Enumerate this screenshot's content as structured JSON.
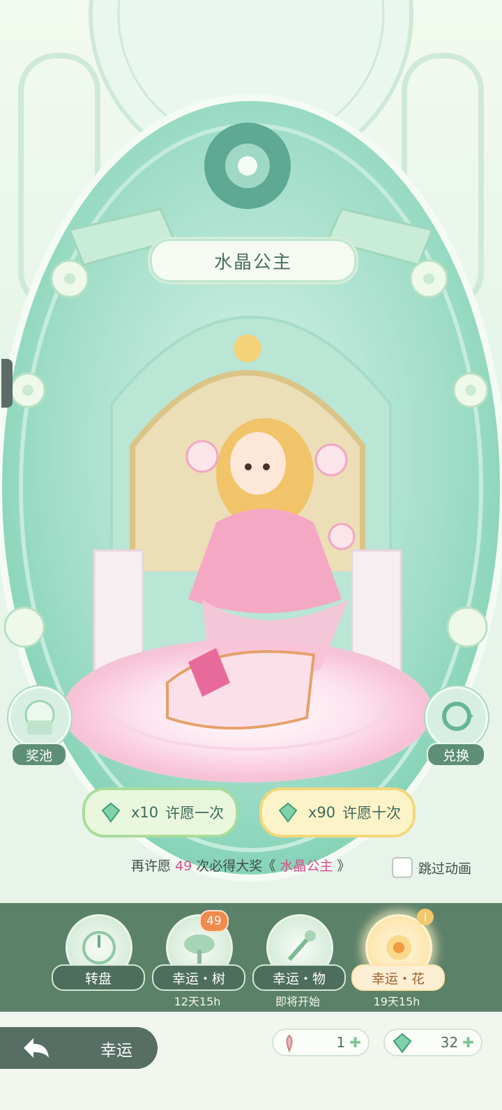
{
  "banner": {
    "title": "水晶公主"
  },
  "side_buttons": {
    "pool_label": "奖池",
    "exchange_label": "兑换"
  },
  "wish": {
    "single": {
      "cost": "x10",
      "label": "许愿一次"
    },
    "ten": {
      "cost": "x90",
      "label": "许愿十次"
    }
  },
  "hint": {
    "prefix": "再许愿",
    "count": "49",
    "middle": "次必得大奖《",
    "prize": "水晶公主",
    "suffix": "》"
  },
  "skip_label": "跳过动画",
  "tabs": [
    {
      "label": "转盘",
      "sub": ""
    },
    {
      "label": "幸运・树",
      "sub": "12天15h",
      "badge": "49"
    },
    {
      "label": "幸运・物",
      "sub": "即将开始"
    },
    {
      "label": "幸运・花",
      "sub": "19天15h",
      "active": true
    }
  ],
  "footer": {
    "back_label": "幸运",
    "currency1": "1",
    "currency2": "32"
  },
  "colors": {
    "accent_green": "#5b8169",
    "highlight_pink": "#d94d8a",
    "gold": "#f7d27c"
  }
}
